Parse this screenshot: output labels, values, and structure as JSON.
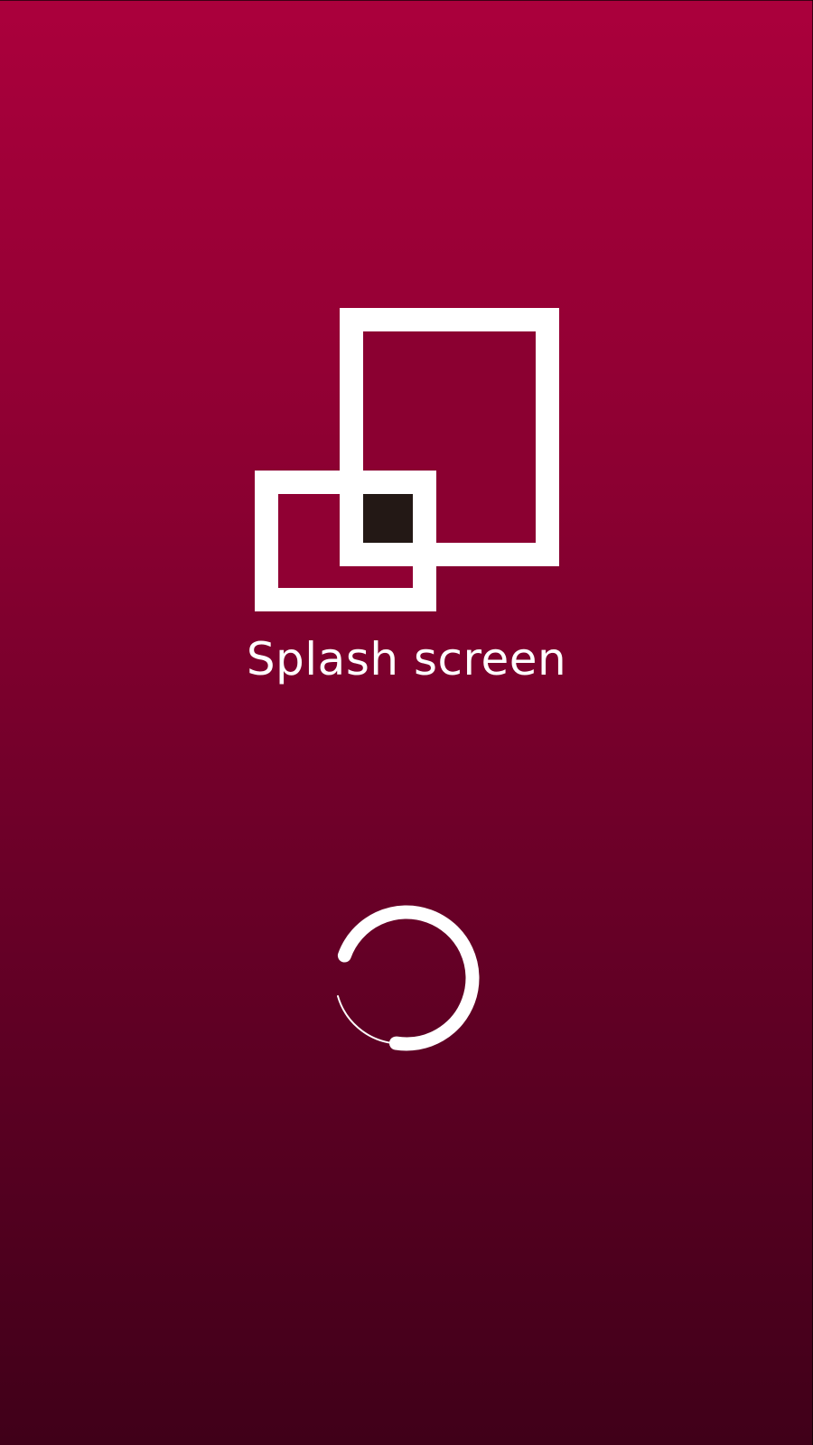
{
  "app": {
    "title": "Splash screen"
  },
  "logo": {
    "icon": "overlapping-squares-logo-icon",
    "color": "#ffffff",
    "overlap_color": "#231815"
  },
  "loading": {
    "icon": "loading-spinner-icon"
  },
  "colors": {
    "gradient_top": "#ab003c",
    "gradient_bottom": "#400019",
    "text": "#ffffff"
  }
}
